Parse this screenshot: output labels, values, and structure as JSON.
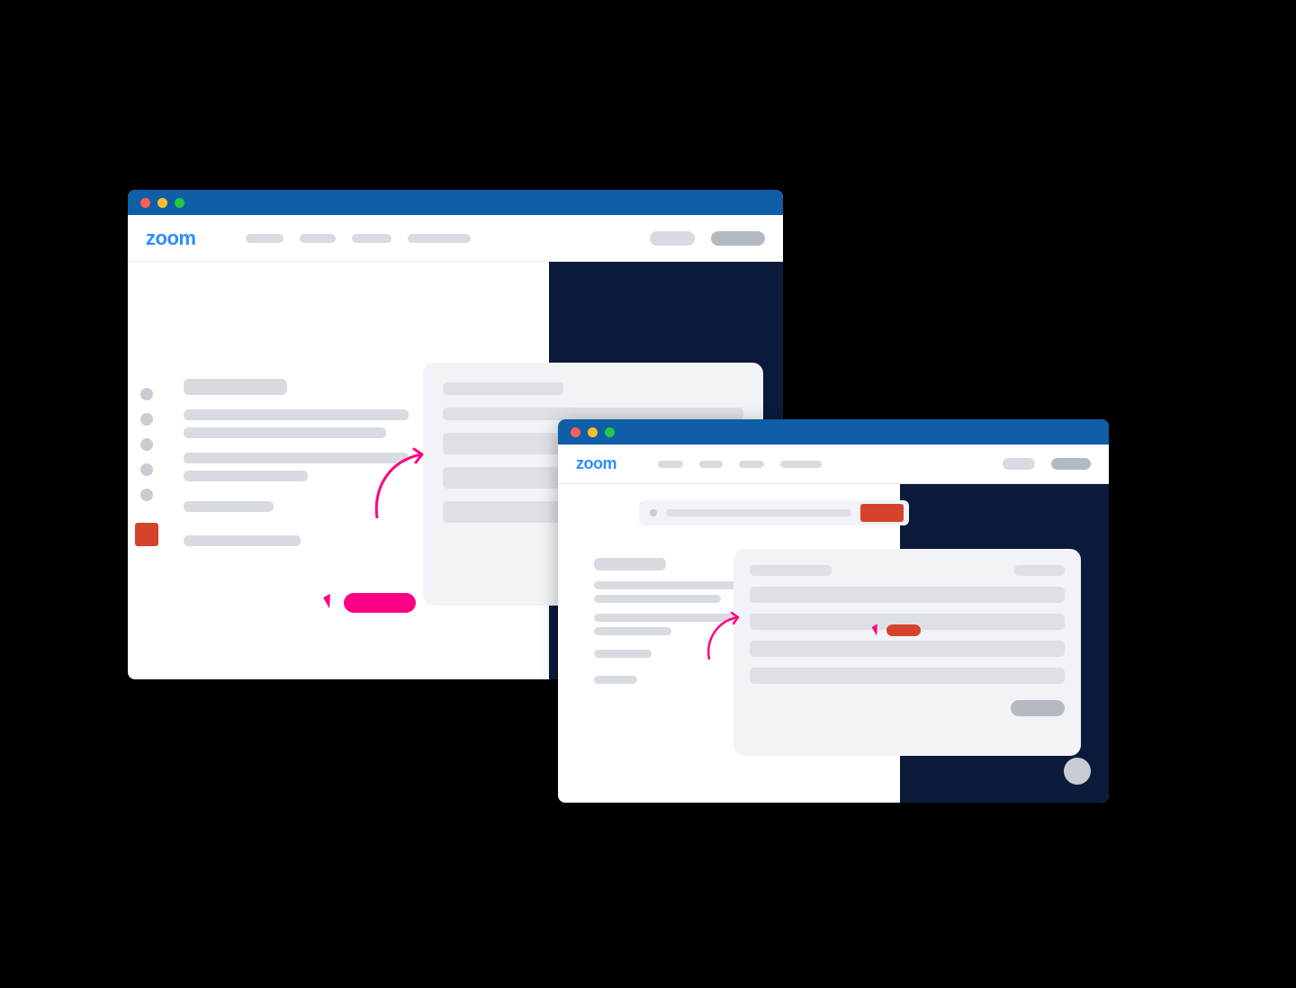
{
  "colors": {
    "background": "#000000",
    "titlebar": "#0f5ea8",
    "brand": "#2d8cff",
    "dark_panel": "#0b1a3a",
    "placeholder_light": "#d8dbe0",
    "placeholder_mid": "#dde0e5",
    "placeholder_dark": "#b5b9c2",
    "card_bg": "#f1f3f6",
    "accent_red": "#d6432b",
    "hot_pink": "#ff0084",
    "traffic_red": "#ff5f56",
    "traffic_yellow": "#ffbd2e",
    "traffic_green": "#27c93f"
  },
  "windows": {
    "primary": {
      "logo_text": "zoom",
      "nav_items_count": 4,
      "nav_right_pills": 2,
      "side_rail_dots": 5,
      "side_rail_has_red_square": true,
      "content_lines": 7,
      "card_lines": 5,
      "has_cursor": true,
      "has_arrow": true,
      "has_pink_pill_button": true
    },
    "secondary": {
      "logo_text": "zoom",
      "nav_items_count": 4,
      "nav_right_pills": 2,
      "search_has_red_button": true,
      "content_lines": 7,
      "card_lines": 4,
      "card_has_header": true,
      "card_has_footer_pill": true,
      "has_red_pill_in_card": true,
      "has_cursor": true,
      "has_arrow": true,
      "has_fab": true
    }
  }
}
